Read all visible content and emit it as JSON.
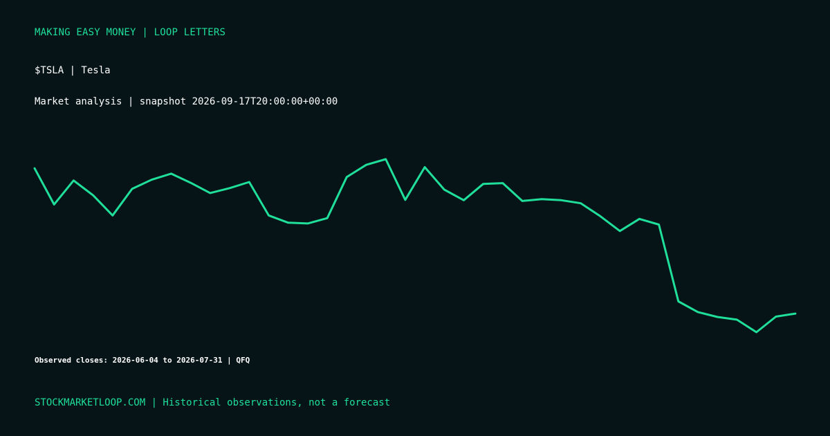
{
  "header": {
    "brand": "MAKING EASY MONEY | LOOP LETTERS",
    "ticker_line": "$TSLA | Tesla",
    "subtitle": "Market analysis | snapshot 2026-09-17T20:00:00+00:00"
  },
  "chart_data": {
    "type": "line",
    "title": "",
    "xlabel": "",
    "ylabel": "",
    "axes_visible": false,
    "grid": false,
    "line_color": "#1fdf9a",
    "series": [
      {
        "values": [
          100,
          90.5,
          96.8,
          92.9,
          87.6,
          94.6,
          97.0,
          98.6,
          96.2,
          93.5,
          94.8,
          96.4,
          87.6,
          85.7,
          85.5,
          86.9,
          97.7,
          100.9,
          102.4,
          91.7,
          100.3,
          94.4,
          91.6,
          95.9,
          96.1,
          91.4,
          91.9,
          91.6,
          90.8,
          87.4,
          83.5,
          86.7,
          85.2,
          65.0,
          62.2,
          60.9,
          60.2,
          56.9,
          61.0,
          61.8
        ]
      }
    ]
  },
  "range_note": "Observed closes: 2026-06-04 to 2026-07-31 | QFQ",
  "footer": "STOCKMARKETLOOP.COM | Historical observations, not a forecast"
}
